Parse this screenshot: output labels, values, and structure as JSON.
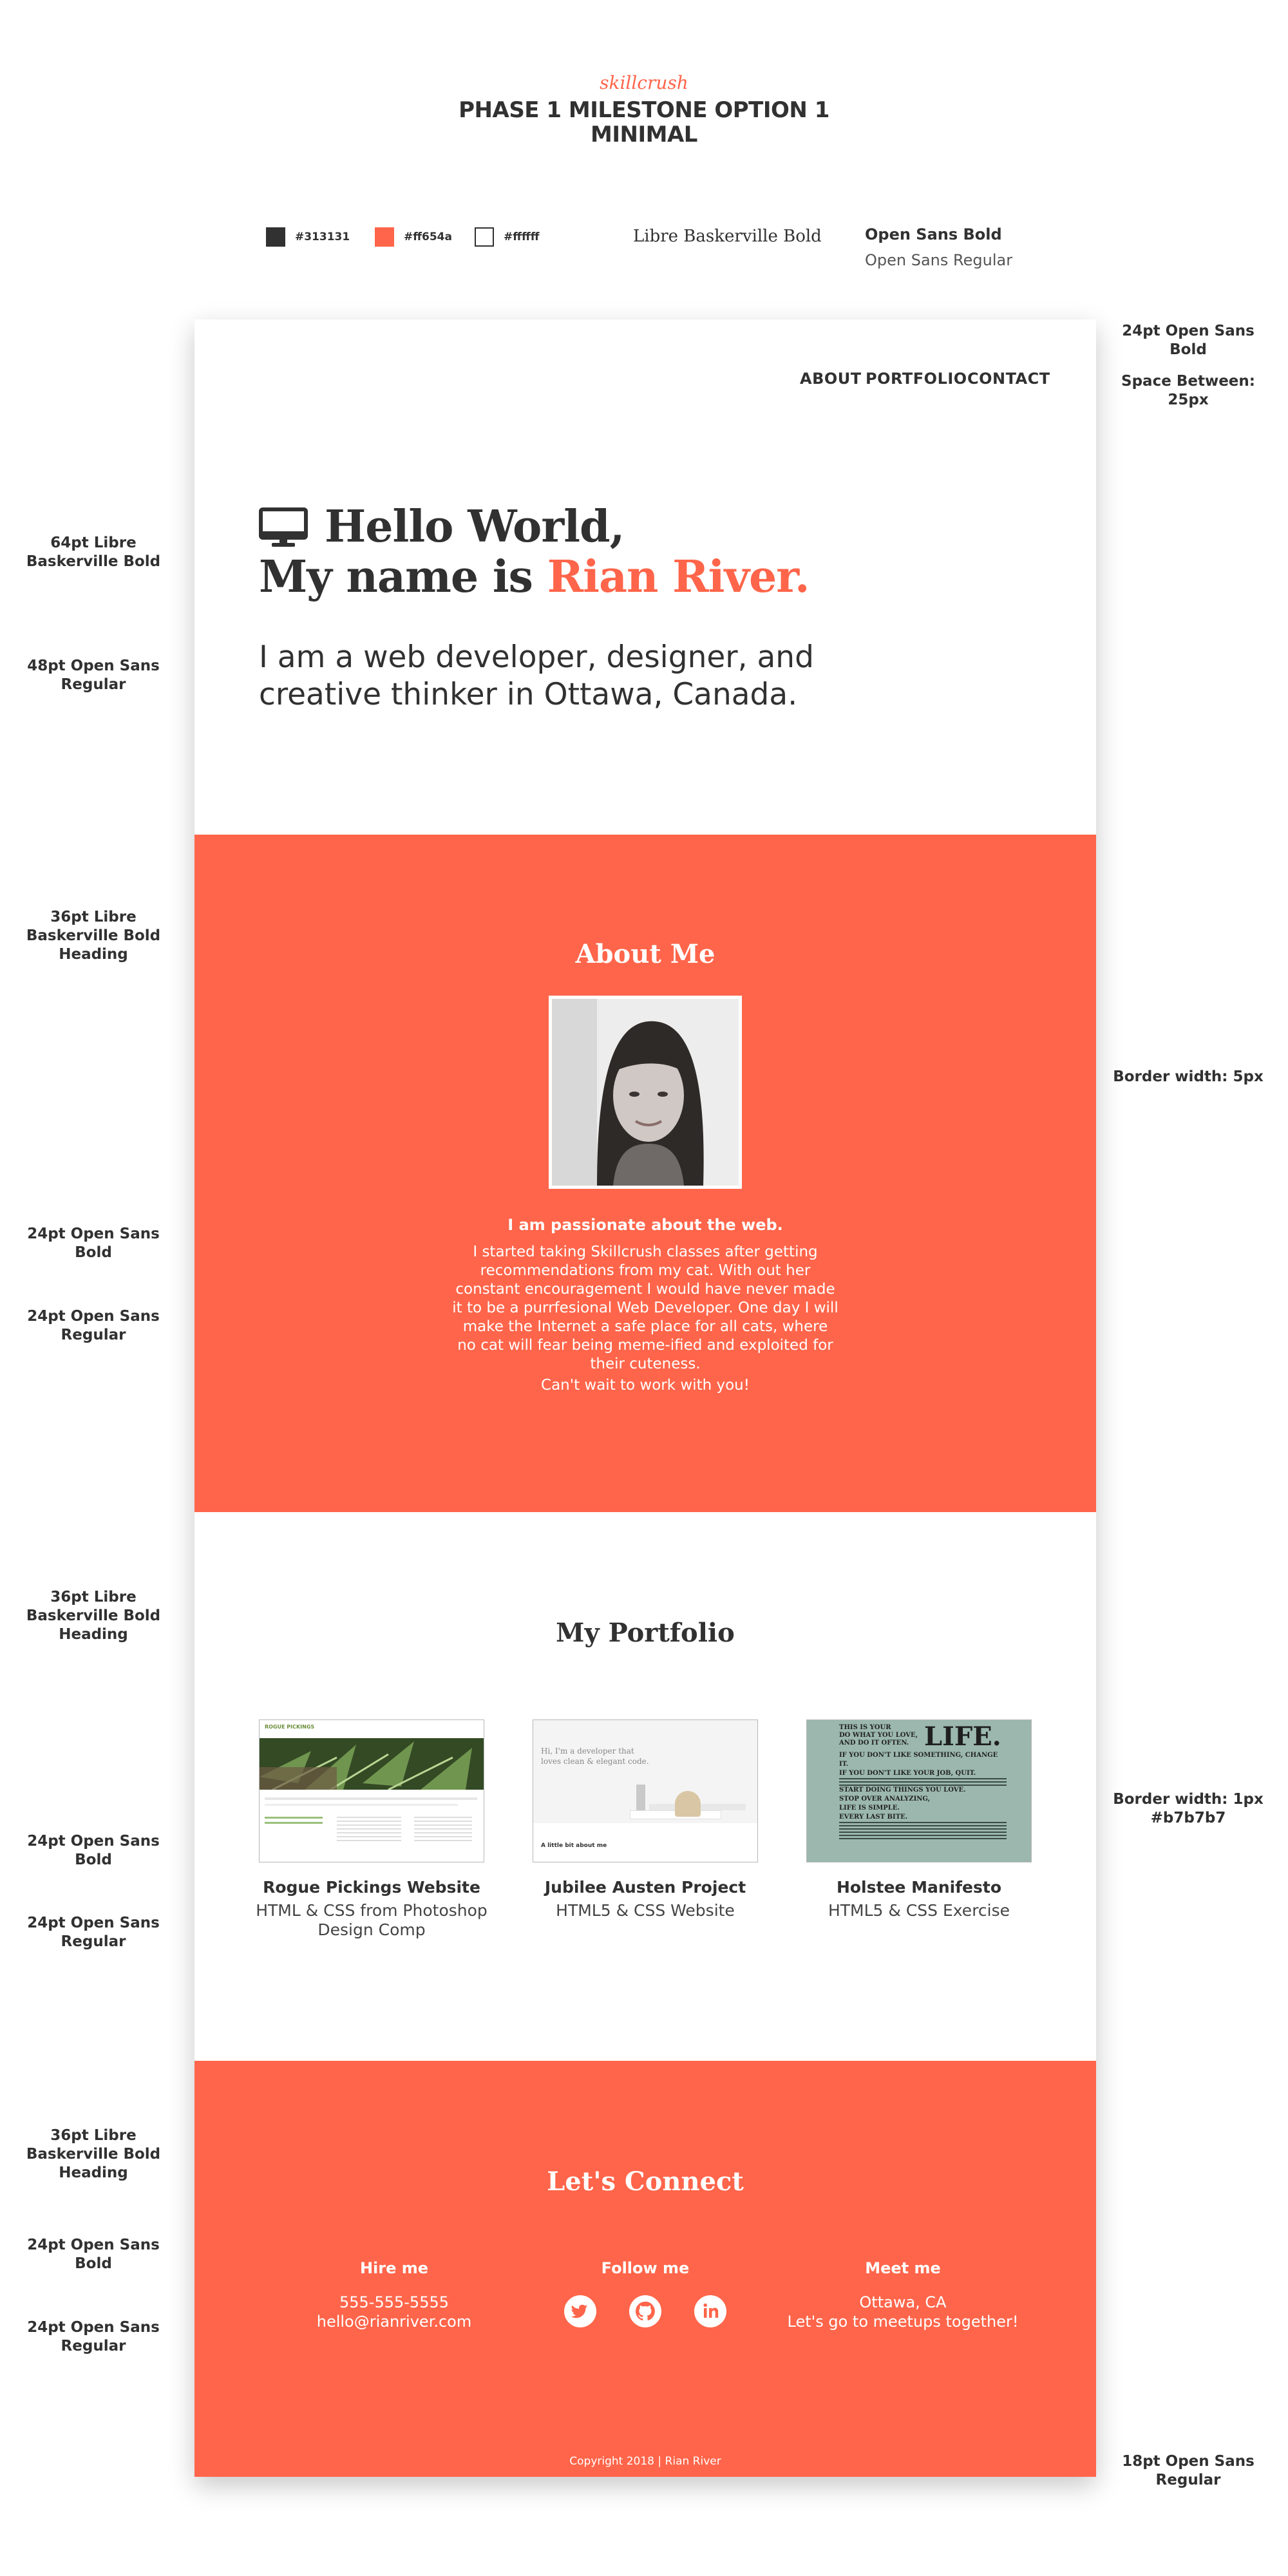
{
  "header": {
    "brand": "skillcrush",
    "title_line1": "PHASE 1 MILESTONE OPTION 1",
    "title_line2": "MINIMAL"
  },
  "palette": [
    {
      "hex": "#313131",
      "label": "#313131"
    },
    {
      "hex": "#ff654a",
      "label": "#ff654a"
    },
    {
      "hex": "#ffffff",
      "label": "#ffffff"
    }
  ],
  "fonts": {
    "serif": "Libre Baskerville Bold",
    "sans_bold": "Open Sans Bold",
    "sans_regular": "Open Sans Regular"
  },
  "notes": {
    "nav_font": "24pt Open Sans Bold",
    "nav_spacing": "Space Between: 25px",
    "hero_heading": "64pt Libre Baskerville Bold",
    "hero_intro": "48pt Open Sans Regular",
    "about_heading": "36pt Libre Baskerville Bold Heading",
    "about_border": "Border width: 5px",
    "about_bold": "24pt Open Sans Bold",
    "about_regular": "24pt Open Sans Regular",
    "portfolio_heading": "36pt Libre Baskerville Bold Heading",
    "portfolio_border": "Border width: 1px #b7b7b7",
    "portfolio_bold": "24pt Open Sans Bold",
    "portfolio_regular": "24pt Open Sans Regular",
    "connect_heading": "36pt Libre Baskerville Bold Heading",
    "connect_bold": "24pt Open Sans Bold",
    "connect_regular": "24pt Open Sans Regular",
    "footer_font": "18pt Open Sans Regular"
  },
  "nav": {
    "about": "ABOUT",
    "portfolio": "PORTFOLIO",
    "contact": "CONTACT"
  },
  "hero": {
    "greeting": "Hello World,",
    "name_prefix": "My name is ",
    "name": "Rian River.",
    "intro": "I am a web developer, designer, and creative thinker in Ottawa, Canada.",
    "icon": "monitor-icon"
  },
  "about": {
    "title": "About Me",
    "bold": "I am passionate about the web.",
    "text": "I started taking Skillcrush classes after getting recommendations from my cat. With out her constant encouragement I would have never made it to be a purrfesional Web Developer. One day I will make the Internet a safe place for all cats, where no cat will fear being meme-ified and exploited for their cuteness.",
    "cta": "Can't wait to work with you!"
  },
  "portfolio": {
    "title": "My Portfolio",
    "items": [
      {
        "title": "Rogue Pickings Website",
        "subtitle": "HTML & CSS from Photoshop Design Comp",
        "thumb_brand": "ROGUE PICKINGS"
      },
      {
        "title": "Jubilee Austen Project",
        "subtitle": "HTML5 & CSS Website",
        "thumb_heading": "Hi, I'm a developer that loves clean & elegant code.",
        "thumb_caption": "A little bit about me"
      },
      {
        "title": "Holstee Manifesto",
        "subtitle": "HTML5 & CSS Exercise",
        "thumb_big": "LIFE.",
        "thumb_lines": [
          "THIS IS YOUR",
          "DO WHAT YOU LOVE,",
          "AND DO IT OFTEN.",
          "IF YOU DON'T LIKE SOMETHING, CHANGE IT.",
          "IF YOU DON'T LIKE YOUR JOB, QUIT.",
          "START DOING THINGS YOU LOVE.",
          "STOP OVER ANALYZING,",
          "LIFE IS SIMPLE.",
          "EVERY LAST BITE."
        ]
      }
    ]
  },
  "connect": {
    "title": "Let's Connect",
    "hire_head": "Hire me",
    "phone": "555-555-5555",
    "email": "hello@rianriver.com",
    "follow_head": "Follow me",
    "social_icons": [
      "twitter-icon",
      "github-icon",
      "linkedin-icon"
    ],
    "meet_head": "Meet me",
    "location": "Ottawa, CA",
    "meetups": "Let's go to meetups together!"
  },
  "footer": {
    "copyright": "Copyright 2018  |  Rian River"
  }
}
